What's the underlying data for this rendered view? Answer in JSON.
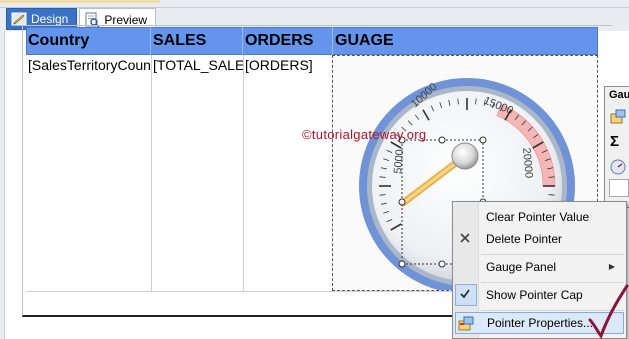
{
  "tabs": [
    {
      "label": "Design",
      "active": true,
      "icon": "design-ruler-icon"
    },
    {
      "label": "Preview",
      "active": false,
      "icon": "preview-icon"
    }
  ],
  "table": {
    "headers": [
      "Country",
      "SALES",
      "ORDERS",
      "GUAGE"
    ],
    "row": [
      "[SalesTerritoryCountry]",
      "[TOTAL_SALES]",
      "[ORDERS]",
      ""
    ]
  },
  "gauge": {
    "scale_labels": [
      "10000",
      "15000",
      "5000",
      "20000"
    ],
    "watermark": "©tutorialgateway.org"
  },
  "right_panel": {
    "title": "Gauge Data",
    "sigma": "Σ"
  },
  "context_menu": {
    "items": [
      {
        "label": "Clear Pointer Value",
        "icon": ""
      },
      {
        "label": "Delete Pointer",
        "icon": "delete-x-icon"
      },
      {
        "label": "Gauge Panel",
        "icon": "",
        "submenu": true
      },
      {
        "label": "Show Pointer Cap",
        "icon": "checkmark-icon",
        "checked": true
      },
      {
        "label": "Pointer Properties...",
        "icon": "properties-icon",
        "highlighted": true
      }
    ]
  },
  "colors": {
    "header_bg": "#6495ED",
    "design_tab": "#3B72C4",
    "watermark": "#B3122B",
    "gauge_ring": "#6F93D6",
    "tick_annotation": "#8B1538"
  }
}
